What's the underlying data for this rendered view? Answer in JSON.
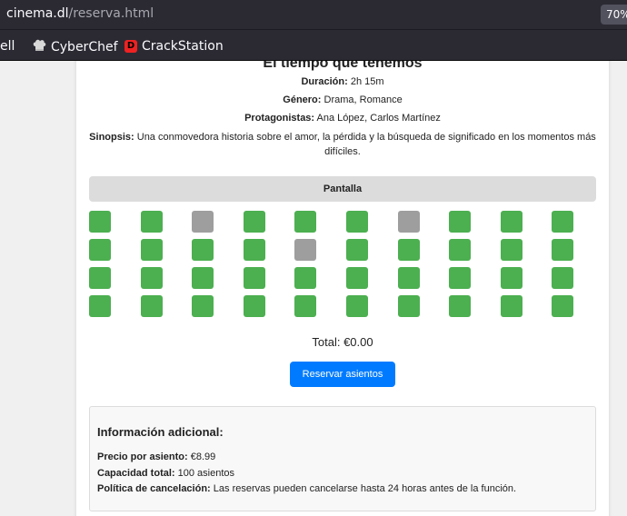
{
  "browser": {
    "url_host": "cinema.dl",
    "url_path": "/reserva.html",
    "zoom": "70%",
    "bookmarks": [
      {
        "label": "ell",
        "icon": "none"
      },
      {
        "label": "CyberChef",
        "icon": "chef-hat-icon"
      },
      {
        "label": "CrackStation",
        "icon": "crackstation-icon",
        "icon_text": "D"
      }
    ]
  },
  "movie": {
    "title": "El tiempo que tenemos",
    "duration_label": "Duración:",
    "duration": "2h 15m",
    "genre_label": "Género:",
    "genre": "Drama, Romance",
    "cast_label": "Protagonistas:",
    "cast": "Ana López, Carlos Martínez",
    "synopsis_label": "Sinopsis:",
    "synopsis": "Una conmovedora historia sobre el amor, la pérdida y la búsqueda de significado en los momentos más difíciles."
  },
  "screen_label": "Pantalla",
  "seats": {
    "rows": [
      [
        "available",
        "available",
        "occupied",
        "available",
        "available",
        "available",
        "occupied",
        "available",
        "available",
        "available"
      ],
      [
        "available",
        "available",
        "available",
        "available",
        "occupied",
        "available",
        "available",
        "available",
        "available",
        "available"
      ],
      [
        "available",
        "available",
        "available",
        "available",
        "available",
        "available",
        "available",
        "available",
        "available",
        "available"
      ],
      [
        "available",
        "available",
        "available",
        "available",
        "available",
        "available",
        "available",
        "available",
        "available",
        "available"
      ]
    ],
    "colors": {
      "available": "#4caf50",
      "occupied": "#9e9e9e"
    }
  },
  "total_text": "Total: €0.00",
  "reserve_button": "Reservar asientos",
  "additional": {
    "title": "Información adicional:",
    "price_label": "Precio por asiento:",
    "price": "€8.99",
    "capacity_label": "Capacidad total:",
    "capacity": "100 asientos",
    "policy_label": "Política de cancelación:",
    "policy": "Las reservas pueden cancelarse hasta 24 horas antes de la función."
  },
  "colors": {
    "accent": "#007bff",
    "chrome_bg": "#2b2a33"
  }
}
